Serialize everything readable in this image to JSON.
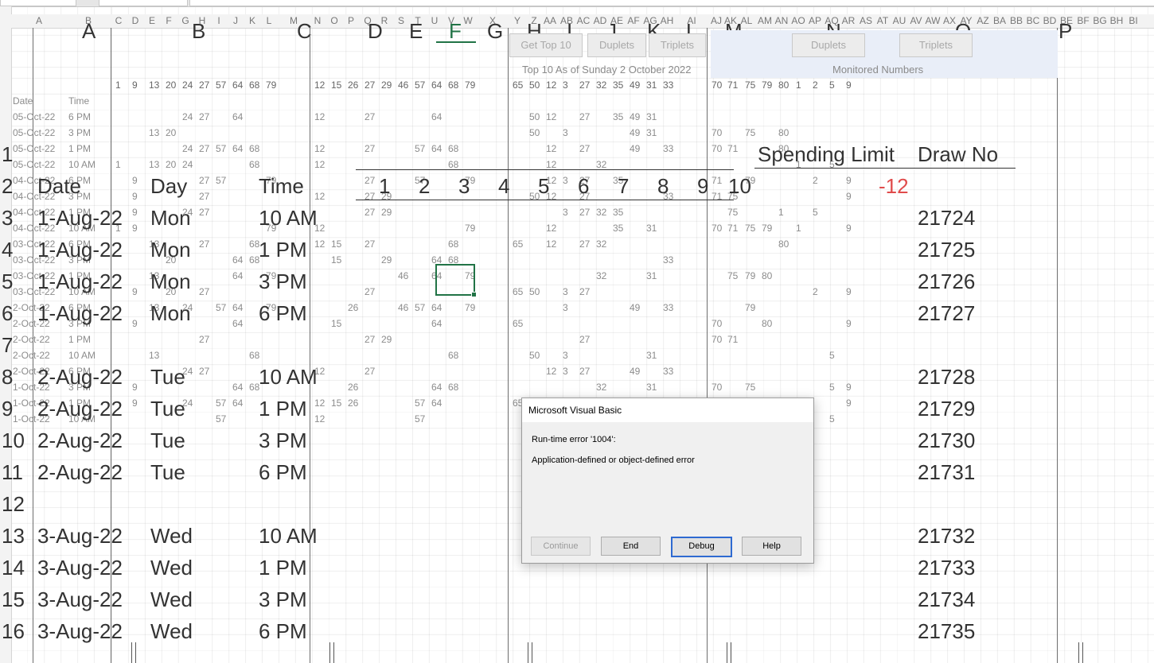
{
  "columns_small": [
    "A",
    "B",
    "C",
    "D",
    "E",
    "F",
    "G",
    "H",
    "I",
    "J",
    "K",
    "L",
    "M",
    "N",
    "O",
    "P",
    "Q",
    "R",
    "S",
    "T",
    "U",
    "V",
    "W",
    "X",
    "Y",
    "Z",
    "AA",
    "AB",
    "AC",
    "AD",
    "AE",
    "AF",
    "AG",
    "AH",
    "AI",
    "AJ",
    "AK",
    "AL",
    "AM",
    "AN",
    "AO",
    "AP",
    "AQ",
    "AR",
    "AS",
    "AT",
    "AU",
    "AV",
    "AW",
    "AX",
    "AY",
    "AZ",
    "BA",
    "BB",
    "BC",
    "BD",
    "BE",
    "BF",
    "BG",
    "BH",
    "BI"
  ],
  "columns_big": [
    "A",
    "B",
    "C",
    "D",
    "E",
    "F",
    "G",
    "H",
    "I",
    "J",
    "K",
    "L",
    "M",
    "N",
    "O",
    "P"
  ],
  "toolbar": {
    "get_top10": "Get Top 10",
    "duplets": "Duplets",
    "triplets": "Triplets",
    "caption": "Top 10 As of Sunday 2 October 2022"
  },
  "monitored": {
    "duplets": "Duplets",
    "triplets": "Triplets",
    "caption": "Monitored Numbers"
  },
  "top10": {
    "headers": {
      "date": "Date",
      "time": "Time",
      "g1": [
        "1",
        "9",
        "13",
        "20",
        "24",
        "27",
        "57",
        "64",
        "68",
        "79"
      ],
      "g2": [
        "12",
        "15",
        "26",
        "27",
        "29",
        "46",
        "57",
        "64",
        "68",
        "79"
      ],
      "g3": [
        "65",
        "50",
        "12",
        "3",
        "27",
        "32",
        "35",
        "49",
        "31",
        "33"
      ],
      "g4": [
        "70",
        "71",
        "75",
        "79",
        "80",
        "1",
        "2",
        "5",
        "9"
      ]
    },
    "rows": [
      {
        "date": "05-Oct-22",
        "time": "6 PM"
      },
      {
        "date": "05-Oct-22",
        "time": "3 PM"
      },
      {
        "date": "05-Oct-22",
        "time": "1 PM"
      },
      {
        "date": "05-Oct-22",
        "time": "10 AM"
      },
      {
        "date": "04-Oct-22",
        "time": "6 PM"
      },
      {
        "date": "04-Oct-22",
        "time": "3 PM"
      },
      {
        "date": "04-Oct-22",
        "time": "1 PM"
      },
      {
        "date": "04-Oct-22",
        "time": "10 AM"
      },
      {
        "date": "03-Oct-22",
        "time": "6 PM"
      },
      {
        "date": "03-Oct-22",
        "time": "3 PM"
      },
      {
        "date": "03-Oct-22",
        "time": "1 PM"
      },
      {
        "date": "03-Oct-22",
        "time": "10 AM"
      },
      {
        "date": "2-Oct-22",
        "time": "6 PM"
      },
      {
        "date": "2-Oct-22",
        "time": "3 PM"
      },
      {
        "date": "2-Oct-22",
        "time": "1 PM"
      },
      {
        "date": "2-Oct-22",
        "time": "10 AM"
      },
      {
        "date": "2-Oct-22",
        "time": "6 PM"
      },
      {
        "date": "1-Oct-22",
        "time": "3 PM"
      },
      {
        "date": "1-Oct-22",
        "time": "1 PM"
      },
      {
        "date": "1-Oct-22",
        "time": "10 AM"
      }
    ]
  },
  "main": {
    "spending_limit_label": "Spending Limit",
    "draw_no_label": "Draw No",
    "spending_value": "-12",
    "headers": {
      "date": "Date",
      "day": "Day",
      "time": "Time",
      "nums": [
        "1",
        "2",
        "3",
        "4",
        "5",
        "6",
        "7",
        "8",
        "9",
        "10"
      ]
    },
    "rows": [
      {
        "num": "1"
      },
      {
        "num": "2"
      },
      {
        "num": "3",
        "date": "1-Aug-22",
        "day": "Mon",
        "time": "10 AM",
        "draw": "21724"
      },
      {
        "num": "4",
        "date": "1-Aug-22",
        "day": "Mon",
        "time": "1 PM",
        "draw": "21725"
      },
      {
        "num": "5",
        "date": "1-Aug-22",
        "day": "Mon",
        "time": "3 PM",
        "draw": "21726"
      },
      {
        "num": "6",
        "date": "1-Aug-22",
        "day": "Mon",
        "time": "6 PM",
        "draw": "21727"
      },
      {
        "num": "7"
      },
      {
        "num": "8",
        "date": "2-Aug-22",
        "day": "Tue",
        "time": "10 AM",
        "draw": "21728"
      },
      {
        "num": "9",
        "date": "2-Aug-22",
        "day": "Tue",
        "time": "1 PM",
        "draw": "21729"
      },
      {
        "num": "10",
        "date": "2-Aug-22",
        "day": "Tue",
        "time": "3 PM",
        "draw": "21730"
      },
      {
        "num": "11",
        "date": "2-Aug-22",
        "day": "Tue",
        "time": "6 PM",
        "draw": "21731"
      },
      {
        "num": "12"
      },
      {
        "num": "13",
        "date": "3-Aug-22",
        "day": "Wed",
        "time": "10 AM",
        "draw": "21732"
      },
      {
        "num": "14",
        "date": "3-Aug-22",
        "day": "Wed",
        "time": "1 PM",
        "draw": "21733"
      },
      {
        "num": "15",
        "date": "3-Aug-22",
        "day": "Wed",
        "time": "3 PM",
        "draw": "21734"
      },
      {
        "num": "16",
        "date": "3-Aug-22",
        "day": "Wed",
        "time": "6 PM",
        "draw": "21735"
      }
    ]
  },
  "dialog": {
    "title": "Microsoft Visual Basic",
    "error_code": "Run-time error '1004':",
    "error_message": "Application-defined or object-defined error",
    "buttons": {
      "continue": "Continue",
      "end": "End",
      "debug": "Debug",
      "help": "Help"
    }
  },
  "cell_values": [
    [
      null,
      null,
      null,
      null,
      "24",
      "27",
      null,
      "64",
      null,
      null,
      "12",
      null,
      null,
      "27",
      null,
      null,
      null,
      "64",
      null,
      null,
      null,
      "50",
      "12",
      null,
      "27",
      null,
      "35",
      "49",
      "31",
      null,
      null,
      null,
      null,
      null,
      null,
      null,
      null,
      null,
      null
    ],
    [
      null,
      null,
      "13",
      "20",
      null,
      null,
      null,
      null,
      null,
      null,
      null,
      null,
      null,
      null,
      null,
      null,
      null,
      null,
      null,
      null,
      null,
      "50",
      null,
      "3",
      null,
      null,
      null,
      "49",
      "31",
      null,
      "70",
      null,
      "75",
      null,
      "80",
      null,
      null,
      null,
      null
    ],
    [
      null,
      null,
      null,
      null,
      "24",
      "27",
      "57",
      "64",
      "68",
      null,
      "12",
      null,
      null,
      "27",
      null,
      null,
      "57",
      "64",
      "68",
      null,
      null,
      null,
      "12",
      null,
      "27",
      null,
      null,
      "49",
      null,
      "33",
      "70",
      "71",
      null,
      null,
      "80",
      null,
      null,
      null,
      null
    ],
    [
      "1",
      null,
      "13",
      "20",
      "24",
      null,
      null,
      null,
      "68",
      null,
      "12",
      null,
      null,
      null,
      null,
      null,
      null,
      null,
      "68",
      null,
      null,
      null,
      "12",
      null,
      null,
      "32",
      null,
      null,
      null,
      null,
      null,
      null,
      null,
      null,
      null,
      "1",
      null,
      "5",
      null
    ],
    [
      null,
      "9",
      null,
      null,
      null,
      "27",
      "57",
      null,
      null,
      "79",
      null,
      null,
      null,
      "27",
      null,
      null,
      "57",
      null,
      null,
      "79",
      null,
      null,
      "12",
      "3",
      "27",
      null,
      "35",
      null,
      null,
      null,
      "71",
      null,
      "79",
      null,
      null,
      null,
      "2",
      null,
      "9"
    ],
    [
      null,
      "9",
      null,
      null,
      null,
      "27",
      null,
      null,
      null,
      null,
      "12",
      null,
      null,
      "27",
      "29",
      null,
      null,
      null,
      null,
      null,
      null,
      "50",
      "12",
      null,
      "27",
      null,
      null,
      null,
      null,
      "33",
      "71",
      "75",
      null,
      null,
      null,
      null,
      null,
      null,
      "9"
    ],
    [
      null,
      "9",
      null,
      null,
      "24",
      "27",
      null,
      null,
      null,
      null,
      null,
      null,
      null,
      "27",
      "29",
      null,
      null,
      null,
      null,
      null,
      null,
      null,
      null,
      "3",
      "27",
      "32",
      "35",
      null,
      null,
      null,
      null,
      "75",
      null,
      null,
      "1",
      null,
      "5",
      null,
      null
    ],
    [
      "1",
      "9",
      null,
      null,
      null,
      null,
      null,
      null,
      null,
      "79",
      "12",
      null,
      null,
      null,
      null,
      null,
      null,
      null,
      null,
      "79",
      null,
      null,
      "12",
      null,
      null,
      null,
      "35",
      null,
      "31",
      null,
      "70",
      "71",
      "75",
      "79",
      null,
      "1",
      null,
      null,
      "9"
    ],
    [
      null,
      null,
      "13",
      null,
      null,
      "27",
      null,
      null,
      "68",
      null,
      "12",
      "15",
      null,
      "27",
      null,
      null,
      null,
      null,
      "68",
      null,
      "65",
      null,
      "12",
      null,
      "27",
      "32",
      null,
      null,
      null,
      null,
      null,
      null,
      null,
      null,
      "80",
      null,
      null,
      null,
      null
    ],
    [
      null,
      null,
      null,
      "20",
      null,
      null,
      null,
      "64",
      "68",
      null,
      null,
      "15",
      null,
      null,
      "29",
      null,
      null,
      "64",
      "68",
      null,
      null,
      null,
      null,
      null,
      null,
      null,
      null,
      null,
      null,
      "33",
      null,
      null,
      null,
      null,
      null,
      null,
      null,
      null,
      null
    ],
    [
      null,
      null,
      "13",
      null,
      null,
      null,
      null,
      "64",
      null,
      "79",
      null,
      null,
      null,
      null,
      null,
      "46",
      null,
      "64",
      null,
      "79",
      null,
      null,
      null,
      null,
      null,
      "32",
      null,
      null,
      "31",
      null,
      null,
      "75",
      "79",
      "80",
      null,
      null,
      null,
      null,
      null
    ],
    [
      null,
      "9",
      null,
      "20",
      null,
      "27",
      null,
      null,
      null,
      null,
      null,
      null,
      null,
      "27",
      null,
      null,
      null,
      null,
      null,
      null,
      "65",
      "50",
      null,
      "3",
      "27",
      null,
      null,
      null,
      null,
      null,
      null,
      null,
      null,
      null,
      null,
      null,
      "2",
      null,
      "9"
    ],
    [
      null,
      null,
      "13",
      null,
      "24",
      null,
      "57",
      "64",
      null,
      "79",
      null,
      null,
      "26",
      null,
      null,
      "46",
      "57",
      "64",
      null,
      "79",
      null,
      null,
      null,
      "3",
      null,
      null,
      null,
      "49",
      null,
      "33",
      null,
      null,
      "79",
      null,
      null,
      null,
      null,
      null,
      null
    ],
    [
      null,
      "9",
      null,
      null,
      null,
      null,
      null,
      "64",
      null,
      null,
      null,
      "15",
      null,
      null,
      null,
      null,
      null,
      "64",
      null,
      null,
      "65",
      null,
      null,
      null,
      null,
      null,
      null,
      null,
      null,
      null,
      "70",
      null,
      null,
      "80",
      null,
      null,
      null,
      null,
      "9"
    ],
    [
      null,
      null,
      null,
      null,
      null,
      "27",
      null,
      null,
      null,
      null,
      null,
      null,
      null,
      "27",
      "29",
      null,
      null,
      null,
      null,
      null,
      null,
      null,
      null,
      null,
      "27",
      null,
      null,
      null,
      null,
      null,
      "70",
      "71",
      null,
      null,
      null,
      null,
      null,
      null,
      null
    ],
    [
      null,
      null,
      "13",
      null,
      null,
      null,
      null,
      null,
      "68",
      null,
      null,
      null,
      null,
      null,
      null,
      null,
      null,
      null,
      "68",
      null,
      null,
      "50",
      null,
      "3",
      null,
      null,
      null,
      null,
      "31",
      null,
      null,
      null,
      null,
      null,
      null,
      null,
      null,
      "5",
      null
    ],
    [
      null,
      null,
      null,
      null,
      "24",
      "27",
      null,
      null,
      null,
      null,
      "12",
      null,
      null,
      "27",
      null,
      null,
      null,
      null,
      null,
      null,
      null,
      null,
      "12",
      "3",
      "27",
      null,
      null,
      "49",
      null,
      "33",
      null,
      null,
      null,
      null,
      null,
      null,
      null,
      null,
      null
    ],
    [
      null,
      "9",
      null,
      null,
      null,
      null,
      null,
      "64",
      "68",
      null,
      null,
      null,
      "26",
      null,
      null,
      null,
      null,
      "64",
      "68",
      null,
      null,
      null,
      null,
      null,
      null,
      "32",
      null,
      null,
      "31",
      null,
      "70",
      null,
      "75",
      null,
      null,
      null,
      null,
      "5",
      "9"
    ],
    [
      null,
      "9",
      null,
      null,
      "24",
      null,
      "57",
      "64",
      null,
      null,
      "12",
      "15",
      "26",
      null,
      null,
      null,
      "57",
      "64",
      null,
      null,
      "65",
      null,
      null,
      null,
      null,
      null,
      null,
      null,
      null,
      null,
      null,
      null,
      null,
      null,
      null,
      null,
      null,
      null,
      "9"
    ],
    [
      null,
      null,
      null,
      null,
      null,
      null,
      "57",
      null,
      null,
      null,
      "12",
      null,
      null,
      null,
      null,
      null,
      "57",
      null,
      null,
      null,
      null,
      null,
      null,
      null,
      null,
      null,
      null,
      null,
      null,
      null,
      null,
      null,
      null,
      null,
      null,
      null,
      null,
      "5",
      null
    ]
  ]
}
